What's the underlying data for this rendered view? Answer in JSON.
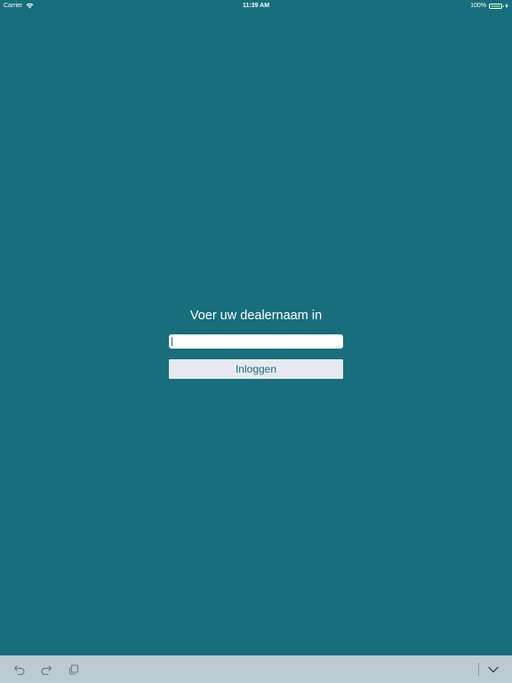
{
  "status_bar": {
    "carrier": "Carrier",
    "time": "11:39 AM",
    "battery_percent": "100%",
    "battery_level": 1.0
  },
  "login": {
    "title": "Voer uw dealernaam in",
    "input_value": "",
    "input_placeholder": "",
    "button_label": "Inloggen"
  },
  "shortcut_bar": {
    "icons": [
      "undo-icon",
      "redo-icon",
      "paste-icon",
      "dismiss-keyboard-icon"
    ]
  },
  "colors": {
    "background": "#186e7c",
    "button_background": "#e6eaf0",
    "button_text": "#186e7c",
    "shortcut_bar": "#bccad3",
    "battery": "#4cd964"
  }
}
